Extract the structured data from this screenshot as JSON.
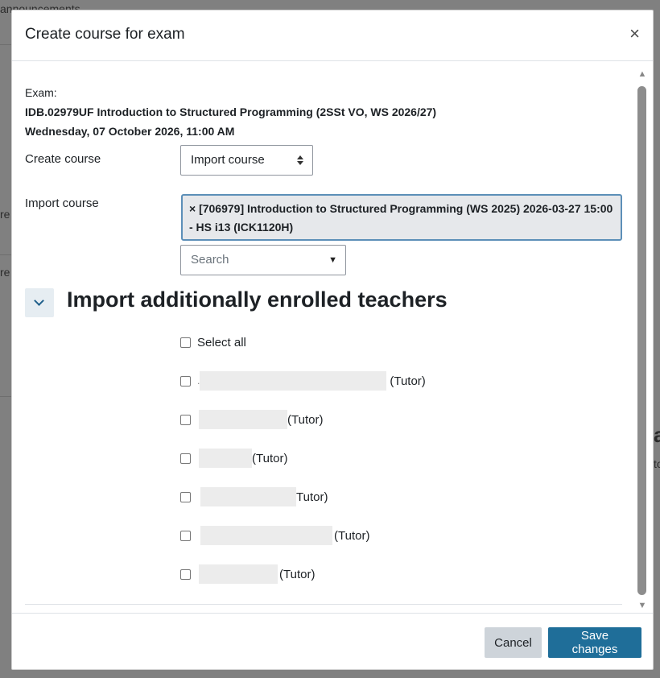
{
  "background": {
    "fragment_top": "announcements",
    "fragment_re1": "re",
    "fragment_re2": "re",
    "fragment_a": "a",
    "fragment_to": "to"
  },
  "modal": {
    "title": "Create course for exam",
    "close_symbol": "×",
    "exam_label": "Exam:",
    "exam_name": "IDB.02979UF Introduction to Structured Programming (2SSt VO, WS 2026/27)",
    "exam_date": "Wednesday, 07 October 2026, 11:00 AM",
    "create_course_label": "Create course",
    "create_course_value": "Import course",
    "import_course_label": "Import course",
    "import_course_selected": "× [706979] Introduction to Structured Programming (WS 2025) 2026-03-27 15:00 - HS i13 (ICK1120H)",
    "search_placeholder": "Search",
    "search_caret": "▼",
    "section_title": "Import additionally enrolled teachers",
    "select_all_label": "Select all",
    "teachers": [
      {
        "prefix": ".",
        "role": "(Tutor)"
      },
      {
        "prefix": "",
        "role": "(Tutor)"
      },
      {
        "prefix": "",
        "role": "(Tutor)"
      },
      {
        "prefix": "",
        "role": "Tutor)"
      },
      {
        "prefix": "",
        "role": "(Tutor)"
      },
      {
        "prefix": "",
        "role": "(Tutor)"
      }
    ]
  },
  "footer": {
    "cancel_label": "Cancel",
    "save_label": "Save changes"
  },
  "colors": {
    "primary": "#1f6e99",
    "secondary": "#ced4da",
    "tag_border": "#5c8fb8"
  }
}
